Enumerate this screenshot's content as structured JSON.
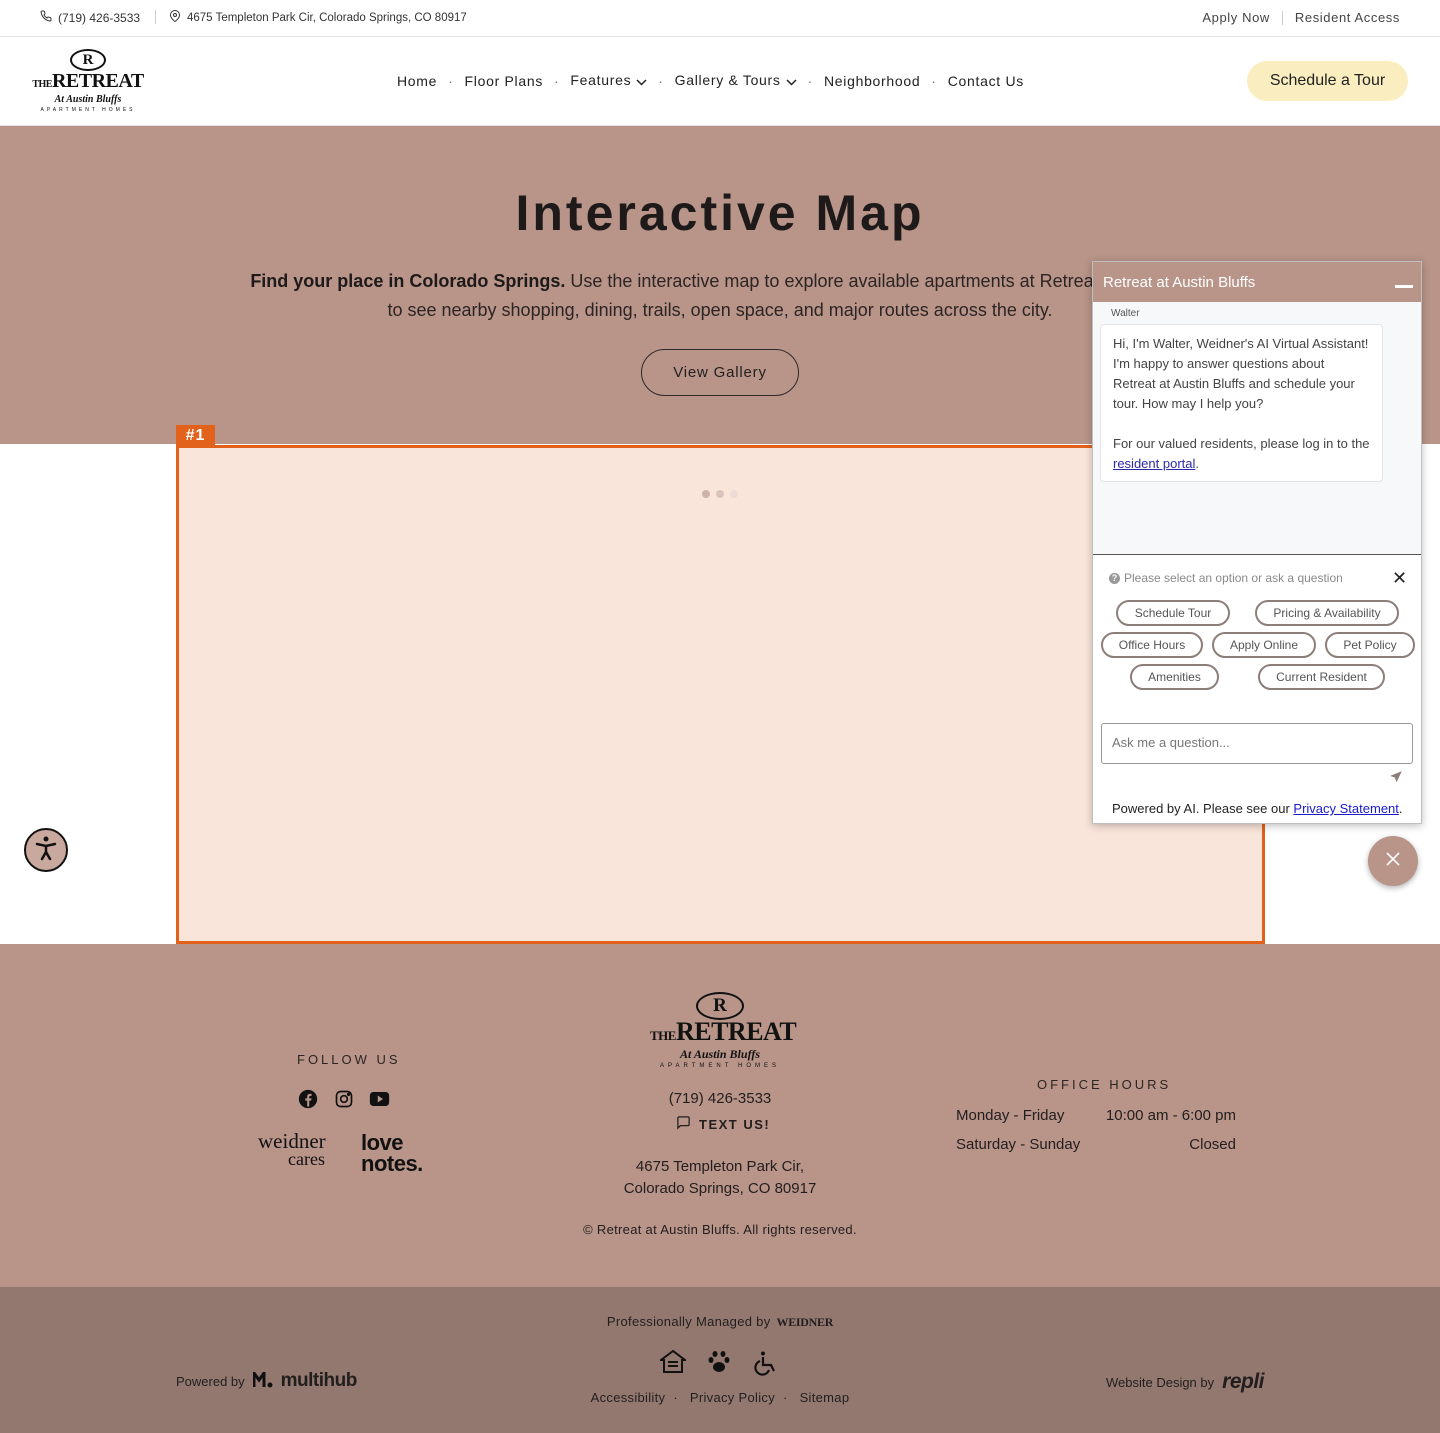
{
  "topbar": {
    "phone": "(719) 426-3533",
    "address": "4675 Templeton Park Cir, Colorado Springs, CO 80917",
    "apply_now": "Apply Now",
    "resident_access": "Resident Access"
  },
  "header": {
    "logo": {
      "mark": "R",
      "the": "THE",
      "name": "RETREAT",
      "script": "At Austin Bluffs",
      "sub": "APARTMENT HOMES"
    },
    "nav": [
      "Home",
      "Floor Plans",
      "Features",
      "Gallery & Tours",
      "Neighborhood",
      "Contact Us"
    ],
    "cta": "Schedule a Tour"
  },
  "hero": {
    "title": "Interactive Map",
    "intro_bold": "Find your place in Colorado Springs.",
    "intro_line1": " Use the interactive map to explore available apartments at Retreat at Austin B",
    "intro_line2": "to see nearby shopping, dining, trails, open space, and major routes across the city.",
    "gallery_button": "View Gallery"
  },
  "map": {
    "tag": "#1"
  },
  "chat": {
    "title": "Retreat at Austin Bluffs",
    "sender": "Walter",
    "message": "Hi, I'm Walter, Weidner's AI Virtual Assistant! I'm happy to answer questions about Retreat at Austin Bluffs and schedule your tour. How may I help you?",
    "resident_note": "For our valued residents, please log in to the",
    "resident_link": "resident portal",
    "prompt": "Please select an option or ask a question",
    "options": [
      "Schedule Tour",
      "Pricing & Availability",
      "Office Hours",
      "Apply Online",
      "Pet Policy",
      "Amenities",
      "Current Resident"
    ],
    "input_placeholder": "Ask me a question...",
    "footer_text": "Powered by AI. Please see our",
    "footer_link": "Privacy Statement"
  },
  "footer": {
    "follow_us": "FOLLOW US",
    "socials": [
      "facebook-icon",
      "instagram-icon",
      "youtube-icon"
    ],
    "partner_weidner_1": "weidner",
    "partner_weidner_2": "cares",
    "partner_love_1": "love",
    "partner_love_2": "notes.",
    "phone": "(719) 426-3533",
    "text_us": "TEXT US!",
    "address_line1": "4675 Templeton Park Cir,",
    "address_line2": "Colorado Springs, CO 80917",
    "copyright": "© Retreat at Austin Bluffs. All rights reserved.",
    "office_hours_title": "OFFICE HOURS",
    "hours": [
      {
        "days": "Monday - Friday",
        "time": "10:00 am - 6:00 pm"
      },
      {
        "days": "Saturday - Sunday",
        "time": "Closed"
      }
    ]
  },
  "bottombar": {
    "managed_by": "Professionally Managed by",
    "manager_brand": "WEIDNER",
    "powered_by": "Powered by",
    "powered_brand": "multihub",
    "design_by": "Website Design by",
    "design_brand": "repli",
    "links": [
      "Accessibility",
      "Privacy Policy",
      "Sitemap"
    ]
  },
  "colors": {
    "brand": "#b89489",
    "brand_dark": "#937870",
    "cta": "#faeec0",
    "highlight": "#e2621b"
  }
}
